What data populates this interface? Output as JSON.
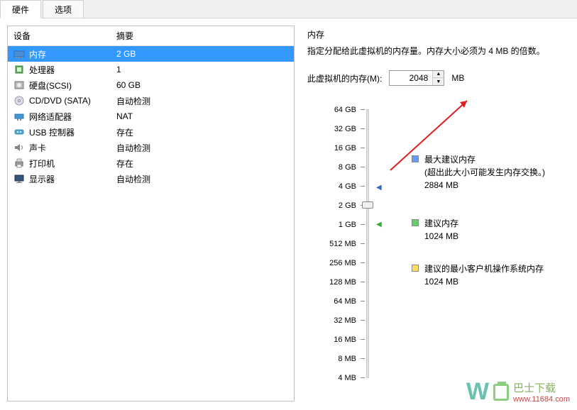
{
  "tabs": {
    "hardware": "硬件",
    "options": "选项"
  },
  "hardware": {
    "header_device": "设备",
    "header_summary": "摘要",
    "rows": [
      {
        "name": "内存",
        "val": "2 GB",
        "icon": "memory-icon",
        "selected": true
      },
      {
        "name": "处理器",
        "val": "1",
        "icon": "cpu-icon"
      },
      {
        "name": "硬盘(SCSI)",
        "val": "60 GB",
        "icon": "disk-icon"
      },
      {
        "name": "CD/DVD (SATA)",
        "val": "自动检测",
        "icon": "cd-icon"
      },
      {
        "name": "网络适配器",
        "val": "NAT",
        "icon": "network-icon"
      },
      {
        "name": "USB 控制器",
        "val": "存在",
        "icon": "usb-icon"
      },
      {
        "name": "声卡",
        "val": "自动检测",
        "icon": "sound-icon"
      },
      {
        "name": "打印机",
        "val": "存在",
        "icon": "printer-icon"
      },
      {
        "name": "显示器",
        "val": "自动检测",
        "icon": "display-icon"
      }
    ]
  },
  "memory": {
    "title": "内存",
    "desc": "指定分配给此虚拟机的内存量。内存大小必须为 4 MB 的倍数。",
    "label": "此虚拟机的内存(M):",
    "value": "2048",
    "unit": "MB",
    "ticks": [
      "64 GB",
      "32 GB",
      "16 GB",
      "8 GB",
      "4 GB",
      "2 GB",
      "1 GB",
      "512 MB",
      "256 MB",
      "128 MB",
      "64 MB",
      "32 MB",
      "16 MB",
      "8 MB",
      "4 MB"
    ],
    "legend": {
      "max": {
        "title": "最大建议内存",
        "note": "(超出此大小可能发生内存交换。)",
        "val": "2884 MB"
      },
      "rec": {
        "title": "建议内存",
        "val": "1024 MB"
      },
      "min": {
        "title": "建议的最小客户机操作系统内存",
        "val": "1024 MB"
      }
    }
  },
  "watermark": {
    "brand": "巴士下载",
    "url": "www.11684.com"
  }
}
